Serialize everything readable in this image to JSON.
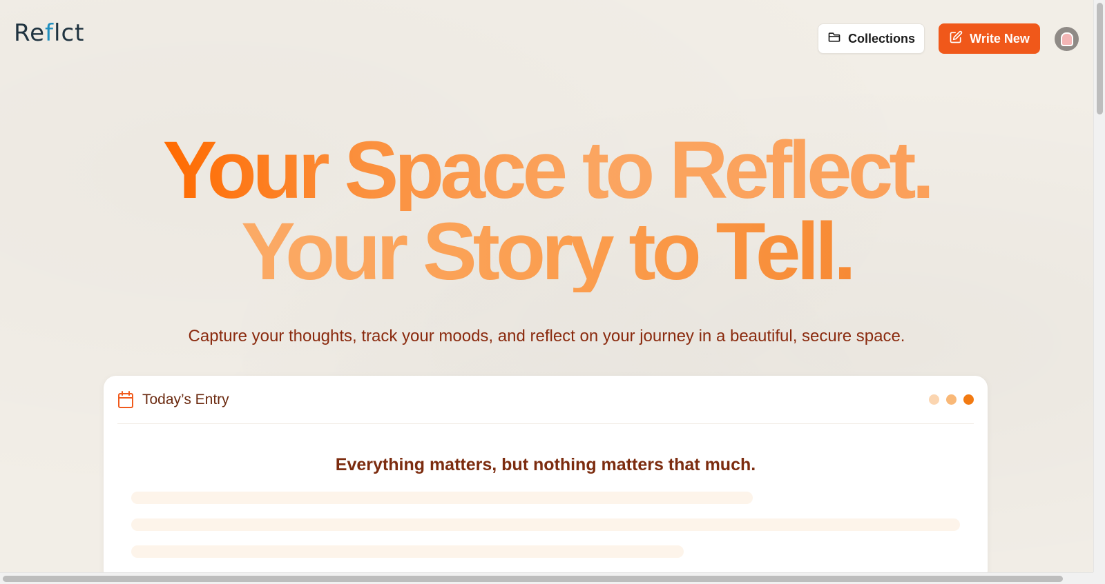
{
  "app": {
    "logo_text_a": "Re",
    "logo_text_pen": "f",
    "logo_text_b": "lct"
  },
  "header": {
    "collections_label": "Collections",
    "collections_icon": "folder-icon",
    "write_label": "Write New",
    "write_icon": "edit-icon",
    "avatar_icon": "avatar"
  },
  "hero": {
    "line1": "Your Space to Reflect.",
    "line2": "Your Story to Tell.",
    "subtitle": "Capture your thoughts, track your moods, and reflect on your journey in a beautiful, secure space."
  },
  "card": {
    "title": "Today’s Entry",
    "title_icon": "calendar-icon",
    "quote": "Everything matters, but nothing matters that much.",
    "dot_colors": [
      "#fbd5b0",
      "#f9b877",
      "#f27a12"
    ]
  },
  "colors": {
    "accent": "#f0581a",
    "text_brown": "#8a2a0e"
  }
}
